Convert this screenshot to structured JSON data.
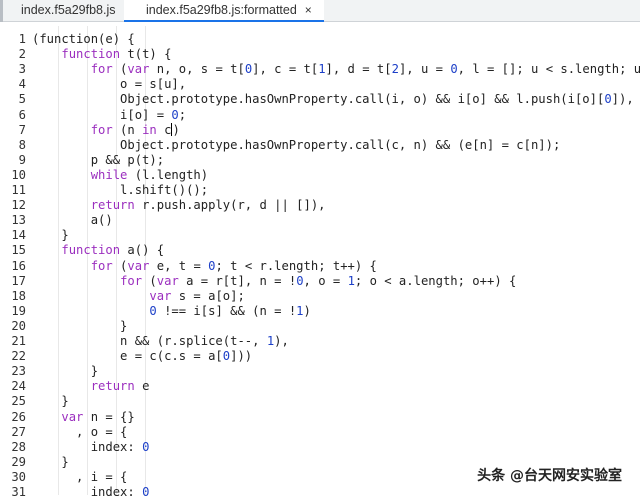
{
  "tabs": [
    {
      "label": "index.f5a29fb8.js"
    },
    {
      "label": "index.f5a29fb8.js:formatted",
      "close": "×",
      "active": true
    }
  ],
  "code_lines": [
    [
      [
        "p",
        "(function(e) {"
      ]
    ],
    [
      [
        "p",
        "    "
      ],
      [
        "k",
        "function"
      ],
      [
        "p",
        " t(t) {"
      ]
    ],
    [
      [
        "p",
        "        "
      ],
      [
        "k",
        "for"
      ],
      [
        "p",
        " ("
      ],
      [
        "k",
        "var"
      ],
      [
        "p",
        " n, o, s = t["
      ],
      [
        "n",
        "0"
      ],
      [
        "p",
        "], c = t["
      ],
      [
        "n",
        "1"
      ],
      [
        "p",
        "], d = t["
      ],
      [
        "n",
        "2"
      ],
      [
        "p",
        "], u = "
      ],
      [
        "n",
        "0"
      ],
      [
        "p",
        ", l = []; u < s.length; u++)"
      ]
    ],
    [
      [
        "p",
        "            o = s[u],"
      ]
    ],
    [
      [
        "p",
        "            Object.prototype.hasOwnProperty.call(i, o) && i[o] && l.push(i[o]["
      ],
      [
        "n",
        "0"
      ],
      [
        "p",
        "]),"
      ]
    ],
    [
      [
        "p",
        "            i[o] = "
      ],
      [
        "n",
        "0"
      ],
      [
        "p",
        ";"
      ]
    ],
    [
      [
        "p",
        "        "
      ],
      [
        "k",
        "for"
      ],
      [
        "p",
        " (n "
      ],
      [
        "k",
        "in"
      ],
      [
        "p",
        " c"
      ],
      [
        "c",
        ""
      ],
      [
        "p",
        ")"
      ]
    ],
    [
      [
        "p",
        "            Object.prototype.hasOwnProperty.call(c, n) && (e[n] = c[n]);"
      ]
    ],
    [
      [
        "p",
        "        p && p(t);"
      ]
    ],
    [
      [
        "p",
        "        "
      ],
      [
        "k",
        "while"
      ],
      [
        "p",
        " (l.length)"
      ]
    ],
    [
      [
        "p",
        "            l.shift()();"
      ]
    ],
    [
      [
        "p",
        "        "
      ],
      [
        "k",
        "return"
      ],
      [
        "p",
        " r.push.apply(r, d || []),"
      ]
    ],
    [
      [
        "p",
        "        a()"
      ]
    ],
    [
      [
        "p",
        "    }"
      ]
    ],
    [
      [
        "p",
        "    "
      ],
      [
        "k",
        "function"
      ],
      [
        "p",
        " a() {"
      ]
    ],
    [
      [
        "p",
        "        "
      ],
      [
        "k",
        "for"
      ],
      [
        "p",
        " ("
      ],
      [
        "k",
        "var"
      ],
      [
        "p",
        " e, t = "
      ],
      [
        "n",
        "0"
      ],
      [
        "p",
        "; t < r.length; t++) {"
      ]
    ],
    [
      [
        "p",
        "            "
      ],
      [
        "k",
        "for"
      ],
      [
        "p",
        " ("
      ],
      [
        "k",
        "var"
      ],
      [
        "p",
        " a = r[t], n = !"
      ],
      [
        "n",
        "0"
      ],
      [
        "p",
        ", o = "
      ],
      [
        "n",
        "1"
      ],
      [
        "p",
        "; o < a.length; o++) {"
      ]
    ],
    [
      [
        "p",
        "                "
      ],
      [
        "k",
        "var"
      ],
      [
        "p",
        " s = a[o];"
      ]
    ],
    [
      [
        "p",
        "                "
      ],
      [
        "n",
        "0"
      ],
      [
        "p",
        " !== i[s] && (n = !"
      ],
      [
        "n",
        "1"
      ],
      [
        "p",
        ")"
      ]
    ],
    [
      [
        "p",
        "            }"
      ]
    ],
    [
      [
        "p",
        "            n && (r.splice(t--, "
      ],
      [
        "n",
        "1"
      ],
      [
        "p",
        "),"
      ]
    ],
    [
      [
        "p",
        "            e = c(c.s = a["
      ],
      [
        "n",
        "0"
      ],
      [
        "p",
        "]))"
      ]
    ],
    [
      [
        "p",
        "        }"
      ]
    ],
    [
      [
        "p",
        "        "
      ],
      [
        "k",
        "return"
      ],
      [
        "p",
        " e"
      ]
    ],
    [
      [
        "p",
        "    }"
      ]
    ],
    [
      [
        "p",
        "    "
      ],
      [
        "k",
        "var"
      ],
      [
        "p",
        " n = {}"
      ]
    ],
    [
      [
        "p",
        "      , o = {"
      ]
    ],
    [
      [
        "p",
        "        index: "
      ],
      [
        "n",
        "0"
      ]
    ],
    [
      [
        "p",
        "    }"
      ]
    ],
    [
      [
        "p",
        "      , i = {"
      ]
    ],
    [
      [
        "p",
        "        index: "
      ],
      [
        "n",
        "0"
      ]
    ]
  ],
  "line_numbers": [
    "1",
    "2",
    "3",
    "4",
    "5",
    "6",
    "7",
    "8",
    "9",
    "10",
    "11",
    "12",
    "13",
    "14",
    "15",
    "16",
    "17",
    "18",
    "19",
    "20",
    "21",
    "22",
    "23",
    "24",
    "25",
    "26",
    "27",
    "28",
    "29",
    "30",
    "31"
  ],
  "watermark": "头条 @台天网安实验室"
}
